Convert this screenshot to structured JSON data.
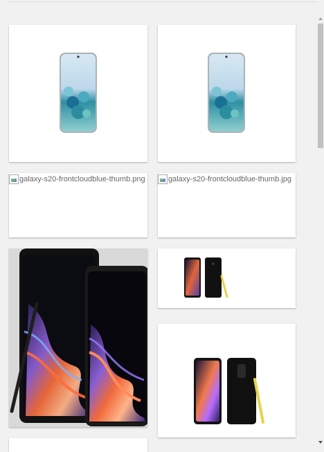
{
  "gallery": {
    "items": [
      {
        "kind": "image",
        "picture": "galaxy-s20-cloud-blue-phone"
      },
      {
        "kind": "image",
        "picture": "galaxy-s20-cloud-blue-phone"
      },
      {
        "kind": "broken",
        "alt": "galaxy-s20-frontcloudblue-thumb.png",
        "icon": "broken-image-icon"
      },
      {
        "kind": "broken",
        "alt": "galaxy-s20-frontcloudblue-thumb.jpg",
        "icon": "broken-image-icon"
      },
      {
        "kind": "image",
        "picture": "galaxy-note9-phones-with-s-pen-closeup"
      },
      {
        "kind": "image",
        "picture": "galaxy-note9-phones-with-yellow-s-pen-small"
      },
      {
        "kind": "image",
        "picture": "galaxy-note9-phones-with-yellow-s-pen"
      },
      {
        "kind": "image",
        "picture": "blank-thumbnail"
      }
    ]
  },
  "scrollbar": {
    "position": 0
  },
  "colors": {
    "background": "#f1f1f1",
    "card": "#ffffff",
    "s_pen": "#e6d34a"
  }
}
